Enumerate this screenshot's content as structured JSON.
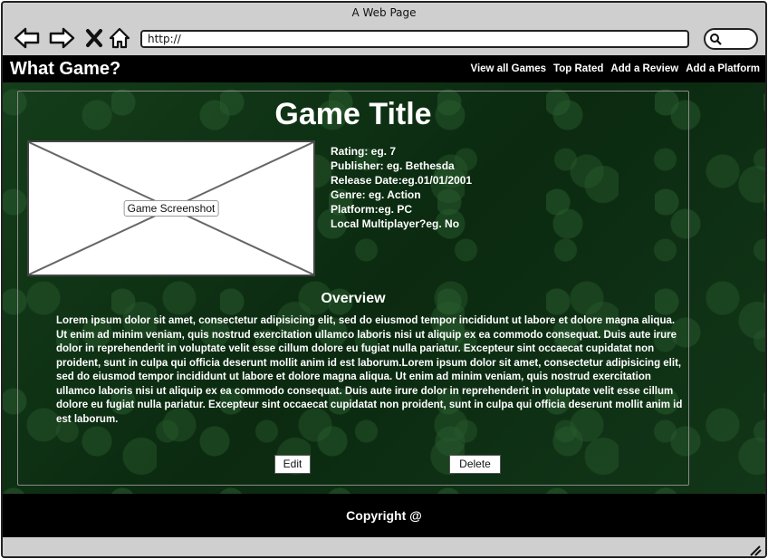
{
  "window": {
    "title": "A Web Page"
  },
  "browser": {
    "url": "http://",
    "icons": [
      "back-arrow-icon",
      "forward-arrow-icon",
      "close-x-icon",
      "home-icon",
      "search-icon"
    ]
  },
  "header": {
    "brand": "What Game?",
    "nav": [
      "View all Games",
      "Top Rated",
      "Add a Review",
      "Add a Platform"
    ]
  },
  "game": {
    "title": "Game Title",
    "image_label": "Game Screenshot",
    "details": [
      "Rating: eg. 7",
      "Publisher: eg. Bethesda",
      "Release Date:eg.01/01/2001",
      "Genre: eg. Action",
      "Platform:eg. PC",
      "Local Multiplayer?eg. No"
    ],
    "overview_title": "Overview",
    "overview_text": "Lorem ipsum dolor sit amet, consectetur adipisicing elit, sed do eiusmod tempor incididunt ut labore et dolore magna aliqua. Ut enim ad minim veniam, quis nostrud exercitation ullamco laboris nisi ut aliquip ex ea commodo consequat. Duis aute irure dolor in reprehenderit in voluptate velit esse cillum dolore eu fugiat nulla pariatur. Excepteur sint occaecat cupidatat non proident, sunt in culpa qui officia deserunt mollit anim id est laborum.Lorem ipsum dolor sit amet, consectetur adipisicing elit, sed do eiusmod tempor incididunt ut labore et dolore magna aliqua. Ut enim ad minim veniam, quis nostrud exercitation ullamco laboris nisi ut aliquip ex ea commodo consequat. Duis aute irure dolor in reprehenderit in voluptate velit esse cillum dolore eu fugiat nulla pariatur. Excepteur sint occaecat cupidatat non proident, sunt in culpa qui officia deserunt mollit anim id est laborum.",
    "edit_label": "Edit",
    "delete_label": "Delete"
  },
  "footer": {
    "copyright": "Copyright @"
  },
  "colors": {
    "header_bg": "#000000",
    "content_bg": "#0d3315",
    "text": "#ffffff",
    "chrome": "#cfcfcf"
  }
}
